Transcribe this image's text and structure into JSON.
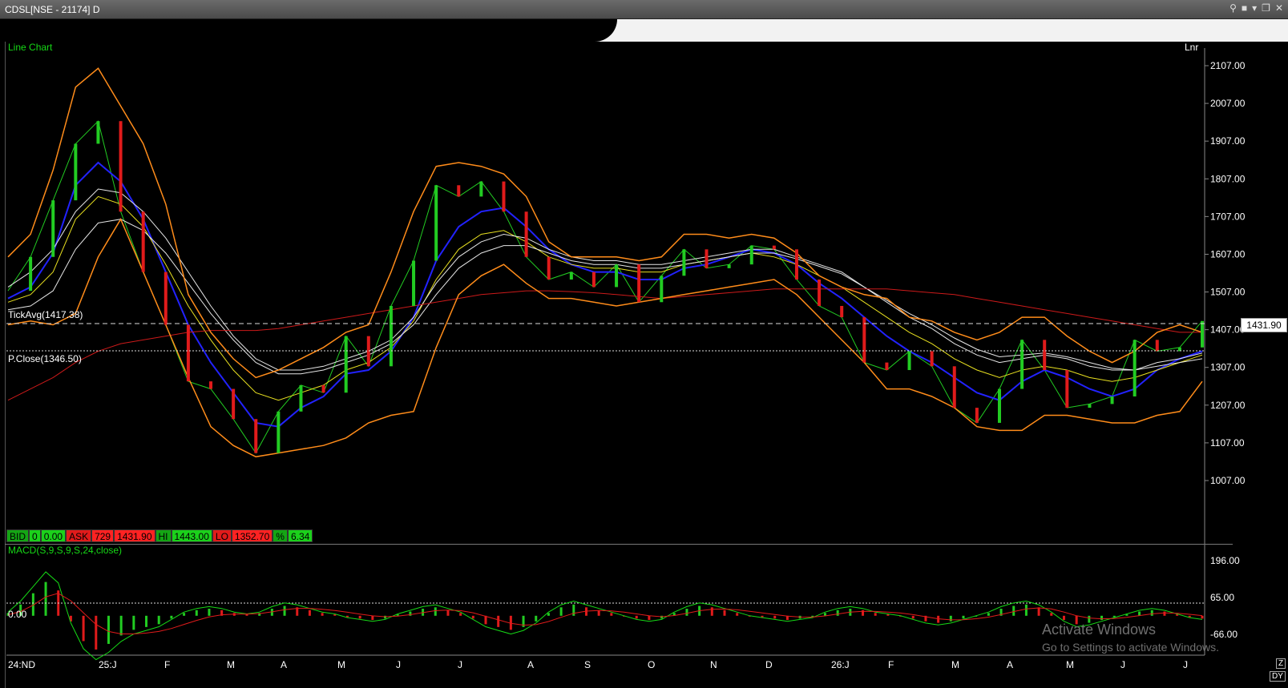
{
  "window": {
    "title": "CDSL[NSE - 21174] D",
    "buttons": [
      "search-icon",
      "save-icon",
      "menu-down-icon",
      "restore-icon",
      "close-icon"
    ]
  },
  "chart_header": {
    "type_label": "Line Chart",
    "scale_label": "Lnr"
  },
  "overlays": {
    "tick_avg": "TickAvg(1417.38)",
    "prev_close": "P.Close(1346.50)",
    "last_price": "1431.90"
  },
  "quote": {
    "bid_label": "BID",
    "bid_qty": "0",
    "bid_price": "0.00",
    "ask_label": "ASK",
    "ask_qty": "729",
    "ask_price": "1431.90",
    "hi_label": "HI",
    "hi_value": "1443.00",
    "lo_label": "LO",
    "lo_value": "1352.70",
    "pct_label": "%",
    "pct_value": "6.34"
  },
  "macd": {
    "label": "MACD(S,9,S,9,S,24,close)",
    "zero_label": "0.00"
  },
  "watermark": {
    "line1": "Activate Windows",
    "line2": "Go to Settings to activate Windows."
  },
  "corner": {
    "zoom": "Z",
    "period": "DY"
  },
  "chart_data": [
    {
      "type": "line",
      "title": "",
      "y_ticks": [
        "2107.00",
        "2007.00",
        "1907.00",
        "1807.00",
        "1707.00",
        "1607.00",
        "1507.00",
        "1407.00",
        "1307.00",
        "1207.00",
        "1107.00",
        "1007.00"
      ],
      "x_ticks": [
        "24:ND",
        "25:J",
        "F",
        "M",
        "A",
        "M",
        "J",
        "J",
        "A",
        "S",
        "O",
        "N",
        "D",
        "26:J",
        "F",
        "M",
        "A",
        "M",
        "J",
        "J"
      ],
      "ylim": [
        1007,
        2107
      ],
      "series": [
        {
          "values": [
            1510,
            1600,
            1750,
            1900,
            1960,
            1720,
            1560,
            1420,
            1270,
            1250,
            1170,
            1080,
            1190,
            1260,
            1240,
            1390,
            1310,
            1470,
            1590,
            1790,
            1760,
            1800,
            1720,
            1600,
            1540,
            1560,
            1520,
            1580,
            1480,
            1550,
            1620,
            1570,
            1580,
            1630,
            1620,
            1540,
            1470,
            1440,
            1320,
            1300,
            1350,
            1310,
            1200,
            1160,
            1250,
            1380,
            1300,
            1200,
            1210,
            1230,
            1380,
            1350,
            1360,
            1430
          ]
        },
        {
          "values": [
            1490,
            1520,
            1610,
            1790,
            1850,
            1800,
            1700,
            1560,
            1420,
            1320,
            1240,
            1160,
            1150,
            1200,
            1230,
            1290,
            1300,
            1350,
            1440,
            1590,
            1680,
            1720,
            1730,
            1680,
            1620,
            1580,
            1560,
            1560,
            1540,
            1540,
            1570,
            1580,
            1600,
            1620,
            1610,
            1580,
            1530,
            1490,
            1440,
            1390,
            1350,
            1320,
            1280,
            1240,
            1220,
            1270,
            1300,
            1280,
            1250,
            1230,
            1250,
            1300,
            1330,
            1350
          ]
        },
        {
          "values": [
            1480,
            1500,
            1560,
            1700,
            1760,
            1740,
            1680,
            1580,
            1470,
            1380,
            1300,
            1240,
            1220,
            1240,
            1260,
            1300,
            1320,
            1360,
            1430,
            1540,
            1620,
            1660,
            1670,
            1640,
            1600,
            1580,
            1570,
            1570,
            1560,
            1560,
            1580,
            1590,
            1600,
            1610,
            1600,
            1580,
            1550,
            1520,
            1480,
            1440,
            1400,
            1370,
            1330,
            1300,
            1280,
            1300,
            1310,
            1300,
            1280,
            1270,
            1280,
            1300,
            1320,
            1340
          ]
        },
        {
          "values": [
            1520,
            1560,
            1620,
            1720,
            1780,
            1770,
            1720,
            1650,
            1560,
            1470,
            1390,
            1330,
            1300,
            1300,
            1310,
            1330,
            1350,
            1380,
            1440,
            1530,
            1600,
            1640,
            1660,
            1650,
            1620,
            1600,
            1590,
            1590,
            1580,
            1580,
            1590,
            1600,
            1610,
            1620,
            1620,
            1600,
            1580,
            1560,
            1520,
            1480,
            1440,
            1410,
            1370,
            1340,
            1320,
            1330,
            1340,
            1330,
            1310,
            1300,
            1300,
            1320,
            1330,
            1345
          ]
        },
        {
          "values": [
            1460,
            1470,
            1510,
            1620,
            1690,
            1700,
            1670,
            1610,
            1530,
            1450,
            1380,
            1320,
            1290,
            1290,
            1300,
            1320,
            1340,
            1370,
            1420,
            1500,
            1570,
            1610,
            1630,
            1630,
            1610,
            1590,
            1580,
            1580,
            1570,
            1570,
            1580,
            1590,
            1600,
            1610,
            1610,
            1595,
            1575,
            1555,
            1520,
            1485,
            1450,
            1420,
            1385,
            1355,
            1335,
            1340,
            1345,
            1335,
            1320,
            1305,
            1300,
            1310,
            1320,
            1330
          ]
        },
        {
          "values": [
            1220,
            1250,
            1280,
            1320,
            1350,
            1370,
            1380,
            1390,
            1400,
            1405,
            1405,
            1405,
            1410,
            1420,
            1430,
            1440,
            1450,
            1460,
            1470,
            1480,
            1490,
            1500,
            1505,
            1510,
            1510,
            1508,
            1505,
            1500,
            1495,
            1490,
            1495,
            1500,
            1505,
            1510,
            1515,
            1515,
            1515,
            1515,
            1515,
            1515,
            1510,
            1505,
            1500,
            1490,
            1480,
            1470,
            1460,
            1450,
            1440,
            1430,
            1420,
            1410,
            1400,
            1400
          ]
        },
        {
          "values": [
            1600,
            1660,
            1830,
            2050,
            2100,
            2000,
            1900,
            1740,
            1500,
            1400,
            1330,
            1280,
            1300,
            1330,
            1360,
            1400,
            1420,
            1560,
            1720,
            1840,
            1850,
            1840,
            1820,
            1760,
            1640,
            1600,
            1600,
            1600,
            1590,
            1600,
            1660,
            1660,
            1650,
            1660,
            1650,
            1610,
            1550,
            1520,
            1500,
            1490,
            1440,
            1430,
            1400,
            1380,
            1400,
            1440,
            1440,
            1390,
            1350,
            1320,
            1350,
            1400,
            1420,
            1400
          ]
        },
        {
          "values": [
            1420,
            1430,
            1420,
            1450,
            1600,
            1700,
            1560,
            1420,
            1280,
            1150,
            1100,
            1070,
            1080,
            1090,
            1100,
            1120,
            1160,
            1180,
            1190,
            1360,
            1500,
            1550,
            1580,
            1530,
            1490,
            1490,
            1480,
            1470,
            1480,
            1490,
            1500,
            1510,
            1520,
            1530,
            1540,
            1500,
            1440,
            1380,
            1320,
            1250,
            1250,
            1230,
            1200,
            1150,
            1140,
            1140,
            1180,
            1180,
            1170,
            1160,
            1160,
            1180,
            1190,
            1270
          ]
        }
      ]
    },
    {
      "type": "bar",
      "title": "",
      "y_ticks": [
        "196.00",
        "65.00",
        "-66.00"
      ],
      "ylim": [
        -140,
        230
      ],
      "values": [
        10,
        40,
        80,
        120,
        90,
        -20,
        -90,
        -120,
        -100,
        -70,
        -50,
        -40,
        -30,
        -10,
        10,
        20,
        25,
        20,
        10,
        5,
        10,
        25,
        35,
        30,
        20,
        10,
        5,
        -5,
        -10,
        -15,
        -10,
        5,
        15,
        25,
        30,
        20,
        10,
        -10,
        -30,
        -40,
        -50,
        -40,
        -20,
        10,
        30,
        40,
        30,
        20,
        10,
        0,
        -10,
        -15,
        -10,
        10,
        25,
        35,
        30,
        20,
        10,
        0,
        -5,
        -10,
        -15,
        -10,
        -5,
        10,
        20,
        25,
        20,
        10,
        5,
        0,
        -10,
        -20,
        -25,
        -20,
        -10,
        0,
        10,
        25,
        35,
        40,
        30,
        10,
        -15,
        -30,
        -25,
        -15,
        -5,
        5,
        15,
        20,
        15,
        5,
        -5,
        -10
      ]
    }
  ]
}
